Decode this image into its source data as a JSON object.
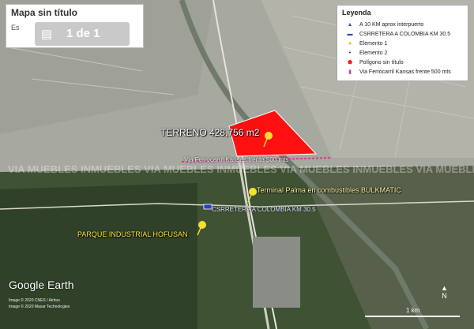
{
  "title_box": {
    "title": "Mapa sin título",
    "subtitle": "Es",
    "page_indicator": "1 de 1",
    "page_icon": "book-icon"
  },
  "legend": {
    "header": "Leyenda",
    "items": [
      {
        "icon": "blue-triangle-icon",
        "label": "A 10 KM aprox interpuerto",
        "color": "#3a4fd6"
      },
      {
        "icon": "car-icon",
        "label": "CSRRETERA A COLOMBIA KM 30.5",
        "color": "#2b3fc4"
      },
      {
        "icon": "yellow-pushpin-icon",
        "label": "Elemento 1",
        "color": "#f2e033"
      },
      {
        "icon": "black-dot-icon",
        "label": "Elemento 2",
        "color": "#222222"
      },
      {
        "icon": "red-polygon-icon",
        "label": "Polígono sin título",
        "color": "#ff1a1a"
      },
      {
        "icon": "train-icon",
        "label": "Via Ferrocarril Kansas frente 500 mts",
        "color": "#c0449a"
      }
    ]
  },
  "map_labels": {
    "terreno": "TERRENO 428,756 m2",
    "kansas": "Via Ferrocarril Kansas frente 500 mts",
    "bulk": "Terminal Palma en combustibles BULKMATIC",
    "km": "CSRRETERA A COLOMBIA KM 30.5",
    "parque": "PARQUE INDUSTRIAL HOFUSAN"
  },
  "watermark": "VIA MUEBLES INMUEBLES VIA MUEBLES INMUEBLES VIA MUEBLES INMUEBLES VIA MUEBLES",
  "footer": {
    "logo": "Google Earth",
    "credit_1": "Image © 2020 CNES / Airbus",
    "credit_2": "Image © 2020 Maxar Technologies",
    "scale_label": "1 km",
    "north_label": "N"
  },
  "colors": {
    "polygon": "#ff1010",
    "pin": "#f2e033",
    "railway": "#d23c9a"
  }
}
